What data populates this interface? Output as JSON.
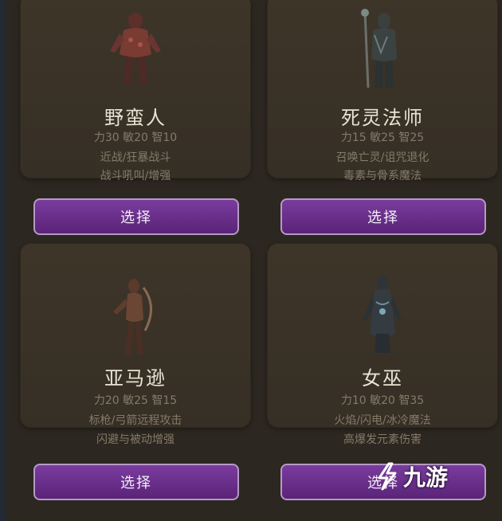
{
  "characters": [
    {
      "name": "野蛮人",
      "stats": "力30 敏20 智10",
      "line1": "近战/狂暴战斗",
      "line2": "战斗吼叫/增强",
      "button": "选择",
      "accent": "#7a3b32"
    },
    {
      "name": "死灵法师",
      "stats": "力15 敏25 智25",
      "line1": "召唤亡灵/诅咒退化",
      "line2": "毒素与骨系魔法",
      "button": "选择",
      "accent": "#5d6a6a"
    },
    {
      "name": "亚马逊",
      "stats": "力20 敏25 智15",
      "line1": "标枪/弓箭远程攻击",
      "line2": "闪避与被动增强",
      "button": "选择",
      "accent": "#6b4634"
    },
    {
      "name": "女巫",
      "stats": "力10 敏20 智35",
      "line1": "火焰/闪电/冰冷魔法",
      "line2": "高爆发元素伤害",
      "button": "选择",
      "accent": "#4f6a7a"
    }
  ],
  "watermark": {
    "text": "九游",
    "icon": "jiuyou-logo-icon"
  }
}
